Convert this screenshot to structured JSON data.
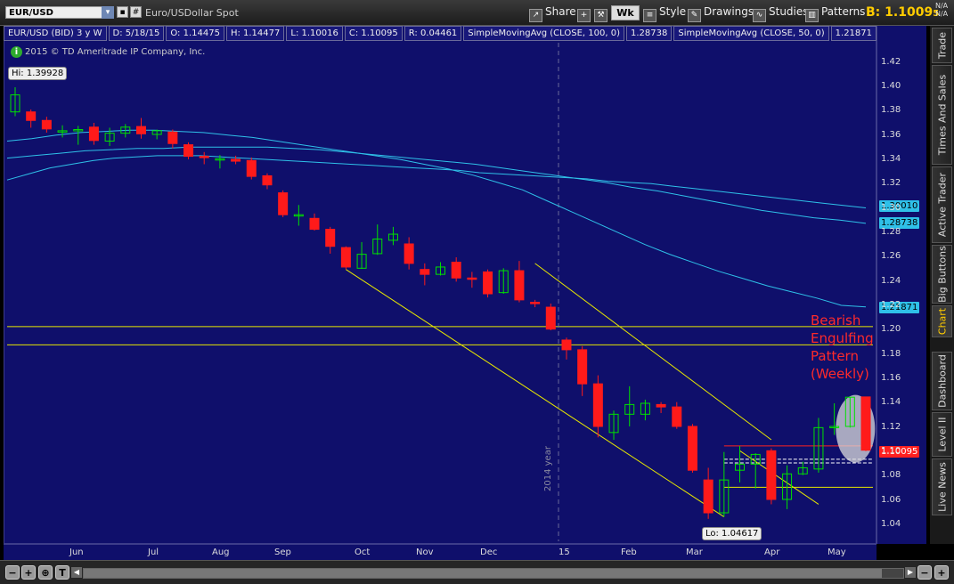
{
  "toolbar": {
    "symbol": "EUR/USD",
    "description": "Euro/USDollar Spot",
    "share": "Share",
    "period": "Wk",
    "style": "Style",
    "drawings": "Drawings",
    "studies": "Studies",
    "patterns": "Patterns",
    "bid_label": "B:",
    "bid_value": "1.1009",
    "bid_sub": "5",
    "na1": "N/A",
    "na2": "N/A"
  },
  "info_bar": [
    "EUR/USD (BID) 3 y W",
    "D: 5/18/15",
    "O: 1.14475",
    "H: 1.14477",
    "L: 1.10016",
    "C: 1.10095",
    "R: 0.04461",
    "SimpleMovingAvg (CLOSE, 100, 0)",
    "1.28738",
    "SimpleMovingAvg (CLOSE, 50, 0)",
    "1.21871"
  ],
  "copyright": "2015 © TD Ameritrade IP Company, Inc.",
  "hi_label": "Hi: 1.39928",
  "lo_label": "Lo: 1.04617",
  "annotation": [
    "Bearish",
    "Engulfing",
    "Pattern",
    "(Weekly)"
  ],
  "year_label": "2014 year",
  "price_tags": {
    "sma_200": "1.30010",
    "sma_100": "1.28738",
    "sma_50": "1.21871",
    "last": "1.10095"
  },
  "side_tabs": [
    "Trade",
    "Times And Sales",
    "Active Trader",
    "Big Buttons",
    "Chart",
    "Dashboard",
    "Level II",
    "Live News"
  ],
  "chart_data": {
    "type": "candlestick",
    "title": "EUR/USD (BID) 3 y W",
    "ylim": [
      1.02,
      1.44
    ],
    "y_ticks": [
      1.04,
      1.06,
      1.08,
      1.1,
      1.12,
      1.14,
      1.16,
      1.18,
      1.2,
      1.22,
      1.24,
      1.26,
      1.28,
      1.3,
      1.32,
      1.34,
      1.36,
      1.38,
      1.4,
      1.42
    ],
    "x_ticks": [
      "Jun",
      "Jul",
      "Aug",
      "Sep",
      "Oct",
      "Nov",
      "Dec",
      "15",
      "Feb",
      "Mar",
      "Apr",
      "May"
    ],
    "colors": {
      "up": "#00e000",
      "down": "#ff1a1a",
      "sma": "#2fc0e8",
      "trend": "#e6e600",
      "bg": "#0f0f6b"
    },
    "candles": [
      {
        "o": 1.379,
        "h": 1.3993,
        "l": 1.3755,
        "c": 1.393
      },
      {
        "o": 1.379,
        "h": 1.381,
        "l": 1.366,
        "c": 1.372
      },
      {
        "o": 1.372,
        "h": 1.375,
        "l": 1.362,
        "c": 1.365
      },
      {
        "o": 1.3625,
        "h": 1.368,
        "l": 1.358,
        "c": 1.3635
      },
      {
        "o": 1.3635,
        "h": 1.3675,
        "l": 1.352,
        "c": 1.3645
      },
      {
        "o": 1.3665,
        "h": 1.37,
        "l": 1.352,
        "c": 1.3555
      },
      {
        "o": 1.355,
        "h": 1.366,
        "l": 1.351,
        "c": 1.3615
      },
      {
        "o": 1.3615,
        "h": 1.369,
        "l": 1.358,
        "c": 1.3665
      },
      {
        "o": 1.367,
        "h": 1.374,
        "l": 1.357,
        "c": 1.361
      },
      {
        "o": 1.3605,
        "h": 1.3645,
        "l": 1.3565,
        "c": 1.3635
      },
      {
        "o": 1.3625,
        "h": 1.3645,
        "l": 1.349,
        "c": 1.353
      },
      {
        "o": 1.352,
        "h": 1.354,
        "l": 1.34,
        "c": 1.3425
      },
      {
        "o": 1.3425,
        "h": 1.346,
        "l": 1.336,
        "c": 1.3415
      },
      {
        "o": 1.3405,
        "h": 1.3435,
        "l": 1.3325,
        "c": 1.3405
      },
      {
        "o": 1.34,
        "h": 1.343,
        "l": 1.336,
        "c": 1.3385
      },
      {
        "o": 1.339,
        "h": 1.3415,
        "l": 1.3235,
        "c": 1.326
      },
      {
        "o": 1.3265,
        "h": 1.3285,
        "l": 1.3155,
        "c": 1.319
      },
      {
        "o": 1.3125,
        "h": 1.3145,
        "l": 1.2925,
        "c": 1.2945
      },
      {
        "o": 1.2945,
        "h": 1.3025,
        "l": 1.2855,
        "c": 1.2945
      },
      {
        "o": 1.2915,
        "h": 1.2955,
        "l": 1.2815,
        "c": 1.2825
      },
      {
        "o": 1.2825,
        "h": 1.2845,
        "l": 1.2625,
        "c": 1.2685
      },
      {
        "o": 1.2675,
        "h": 1.2685,
        "l": 1.2495,
        "c": 1.2515
      },
      {
        "o": 1.2505,
        "h": 1.272,
        "l": 1.25,
        "c": 1.262
      },
      {
        "o": 1.2625,
        "h": 1.2865,
        "l": 1.2615,
        "c": 1.2745
      },
      {
        "o": 1.2735,
        "h": 1.2845,
        "l": 1.2695,
        "c": 1.2785
      },
      {
        "o": 1.2705,
        "h": 1.276,
        "l": 1.2495,
        "c": 1.2545
      },
      {
        "o": 1.2495,
        "h": 1.2545,
        "l": 1.2365,
        "c": 1.2455
      },
      {
        "o": 1.2455,
        "h": 1.2555,
        "l": 1.2445,
        "c": 1.2515
      },
      {
        "o": 1.2555,
        "h": 1.2595,
        "l": 1.2395,
        "c": 1.2425
      },
      {
        "o": 1.2425,
        "h": 1.2475,
        "l": 1.2345,
        "c": 1.2415
      },
      {
        "o": 1.2475,
        "h": 1.2495,
        "l": 1.2265,
        "c": 1.2295
      },
      {
        "o": 1.2305,
        "h": 1.2505,
        "l": 1.2295,
        "c": 1.2485
      },
      {
        "o": 1.2485,
        "h": 1.2565,
        "l": 1.2225,
        "c": 1.2245
      },
      {
        "o": 1.2225,
        "h": 1.2245,
        "l": 1.2185,
        "c": 1.2215
      },
      {
        "o": 1.2185,
        "h": 1.2215,
        "l": 1.1995,
        "c": 1.2005
      },
      {
        "o": 1.1915,
        "h": 1.1935,
        "l": 1.1755,
        "c": 1.1835
      },
      {
        "o": 1.1835,
        "h": 1.1865,
        "l": 1.1455,
        "c": 1.1555
      },
      {
        "o": 1.1555,
        "h": 1.1625,
        "l": 1.1115,
        "c": 1.1205
      },
      {
        "o": 1.1155,
        "h": 1.1335,
        "l": 1.1095,
        "c": 1.1305
      },
      {
        "o": 1.1305,
        "h": 1.1535,
        "l": 1.1205,
        "c": 1.1385
      },
      {
        "o": 1.1305,
        "h": 1.1425,
        "l": 1.1255,
        "c": 1.1395
      },
      {
        "o": 1.1385,
        "h": 1.1405,
        "l": 1.1315,
        "c": 1.1365
      },
      {
        "o": 1.1365,
        "h": 1.1405,
        "l": 1.1185,
        "c": 1.1205
      },
      {
        "o": 1.1205,
        "h": 1.1225,
        "l": 1.0825,
        "c": 1.0845
      },
      {
        "o": 1.0765,
        "h": 1.0865,
        "l": 1.0445,
        "c": 1.0495
      },
      {
        "o": 1.0495,
        "h": 1.0995,
        "l": 1.0462,
        "c": 1.0765
      },
      {
        "o": 1.0845,
        "h": 1.1045,
        "l": 1.0745,
        "c": 1.0895
      },
      {
        "o": 1.0895,
        "h": 1.0985,
        "l": 1.0695,
        "c": 1.0975
      },
      {
        "o": 1.1005,
        "h": 1.1025,
        "l": 1.0565,
        "c": 1.0605
      },
      {
        "o": 1.0605,
        "h": 1.0885,
        "l": 1.0525,
        "c": 1.0815
      },
      {
        "o": 1.0815,
        "h": 1.0915,
        "l": 1.0805,
        "c": 1.0865
      },
      {
        "o": 1.0855,
        "h": 1.1275,
        "l": 1.0825,
        "c": 1.1195
      },
      {
        "o": 1.1195,
        "h": 1.1395,
        "l": 1.1135,
        "c": 1.1205
      },
      {
        "o": 1.1205,
        "h": 1.1445,
        "l": 1.1195,
        "c": 1.1445
      },
      {
        "o": 1.14475,
        "h": 1.14477,
        "l": 1.10016,
        "c": 1.10095
      }
    ],
    "sma_curves": [
      {
        "name": "SimpleMovingAvg (CLOSE, 200, 0)",
        "last": 1.3001,
        "points": [
          1.323,
          1.328,
          1.333,
          1.336,
          1.339,
          1.341,
          1.342,
          1.343,
          1.343,
          1.343,
          1.342,
          1.341,
          1.34,
          1.339,
          1.338,
          1.337,
          1.336,
          1.335,
          1.334,
          1.333,
          1.332,
          1.331,
          1.329,
          1.328,
          1.327,
          1.326,
          1.325,
          1.324,
          1.322,
          1.321,
          1.32,
          1.318,
          1.316,
          1.314,
          1.312,
          1.31,
          1.308,
          1.306,
          1.304,
          1.302,
          1.3001
        ]
      },
      {
        "name": "SimpleMovingAvg (CLOSE, 100, 0)",
        "last": 1.28738,
        "points": [
          1.341,
          1.343,
          1.345,
          1.347,
          1.348,
          1.349,
          1.349,
          1.35,
          1.35,
          1.35,
          1.35,
          1.349,
          1.348,
          1.346,
          1.344,
          1.342,
          1.34,
          1.338,
          1.336,
          1.333,
          1.33,
          1.327,
          1.324,
          1.321,
          1.317,
          1.314,
          1.31,
          1.306,
          1.302,
          1.298,
          1.295,
          1.292,
          1.29,
          1.28738
        ]
      },
      {
        "name": "SimpleMovingAvg (CLOSE, 50, 0)",
        "last": 1.21871,
        "points": [
          1.355,
          1.357,
          1.36,
          1.362,
          1.363,
          1.364,
          1.364,
          1.363,
          1.362,
          1.36,
          1.358,
          1.355,
          1.352,
          1.349,
          1.346,
          1.343,
          1.34,
          1.336,
          1.332,
          1.327,
          1.321,
          1.315,
          1.306,
          1.297,
          1.288,
          1.279,
          1.27,
          1.262,
          1.255,
          1.248,
          1.242,
          1.236,
          1.231,
          1.226,
          1.22,
          1.21871
        ]
      }
    ],
    "horizontal_lines": [
      1.2025,
      1.1875,
      1.1045,
      1.0935,
      1.0905,
      1.0705
    ],
    "trend_lines": [
      {
        "x0": 21,
        "y0": 1.2495,
        "x1": 45,
        "y1": 1.0462
      },
      {
        "x0": 33,
        "y0": 1.2545,
        "x1": 48,
        "y1": 1.1095
      },
      {
        "x0": 46,
        "y0": 1.1005,
        "x1": 51,
        "y1": 1.0565
      }
    ]
  }
}
